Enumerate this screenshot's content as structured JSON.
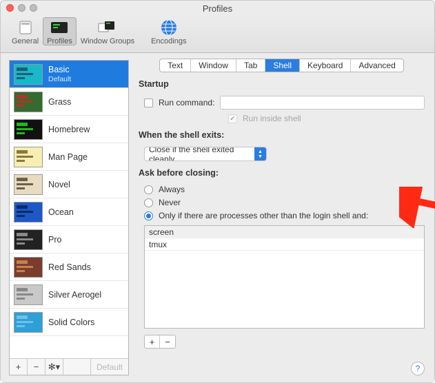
{
  "window": {
    "title": "Profiles"
  },
  "toolbar": {
    "general": "General",
    "profiles": "Profiles",
    "window_groups": "Window Groups",
    "encodings": "Encodings"
  },
  "sidebar": {
    "profiles": [
      {
        "name": "Basic",
        "sub": "Default",
        "thumb_bg": "#17b9c8",
        "thumb_fg": "#1b5f78",
        "selected": true
      },
      {
        "name": "Grass",
        "thumb_bg": "#356b2e",
        "thumb_fg": "#b6302c"
      },
      {
        "name": "Homebrew",
        "thumb_bg": "#111",
        "thumb_fg": "#1fb81f"
      },
      {
        "name": "Man Page",
        "thumb_bg": "#f6eeb3",
        "thumb_fg": "#8b7a3a"
      },
      {
        "name": "Novel",
        "thumb_bg": "#e7dcc0",
        "thumb_fg": "#6b604d"
      },
      {
        "name": "Ocean",
        "thumb_bg": "#1e58c7",
        "thumb_fg": "#0e2a66"
      },
      {
        "name": "Pro",
        "thumb_bg": "#222",
        "thumb_fg": "#888"
      },
      {
        "name": "Red Sands",
        "thumb_bg": "#7c3c2c",
        "thumb_fg": "#c38249"
      },
      {
        "name": "Silver Aerogel",
        "thumb_bg": "#c9c9c9",
        "thumb_fg": "#888"
      },
      {
        "name": "Solid Colors",
        "thumb_bg": "#2da0d6",
        "thumb_fg": "#6fc1e6"
      }
    ],
    "footer": {
      "default_label": "Default"
    }
  },
  "tabs": [
    "Text",
    "Window",
    "Tab",
    "Shell",
    "Keyboard",
    "Advanced"
  ],
  "tab_selected": "Shell",
  "shell": {
    "startup_label": "Startup",
    "run_command_label": "Run command:",
    "run_command_checked": false,
    "run_command_value": "",
    "run_inside_label": "Run inside shell",
    "run_inside_checked": true,
    "exit_title": "When the shell exits:",
    "exit_value": "Close if the shell exited cleanly",
    "ask_title": "Ask before closing:",
    "ask_options": {
      "always": "Always",
      "never": "Never",
      "only_if": "Only if there are processes other than the login shell and:"
    },
    "ask_selected": "only_if",
    "processes": [
      "screen",
      "tmux"
    ]
  },
  "annotation": {
    "arrow_color": "#ff2a13"
  }
}
